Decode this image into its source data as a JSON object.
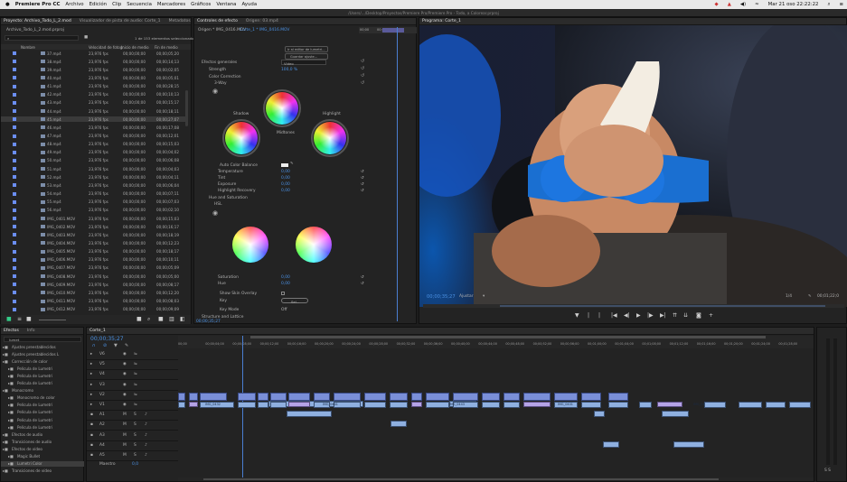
{
  "menubar": {
    "apple": "",
    "app": "Premiere Pro CC",
    "items": [
      "Archivo",
      "Edición",
      "Clip",
      "Secuencia",
      "Marcadores",
      "Gráficos",
      "Ventana",
      "Ayuda"
    ],
    "status": "Mar 21 oso  22:22:22"
  },
  "titlebar": {
    "path": "/Users/.../Desktop/Proyectos/Premiere Pro/Premiere Pro - Todo, a Colorear.prproj"
  },
  "project": {
    "tabs": [
      "Proyecto: Archivo_Todo_L_2.mod",
      "Visualizador de pista de audio: Corte_1",
      "Metadatos"
    ],
    "path": "Archivo_Todo_L_2.mod.prproj",
    "count": "1 de 153 elementos seleccionados",
    "columns": [
      "Nombre",
      "Velocidad de fotogr.",
      "Inicio de medio",
      "Fin de medio"
    ],
    "rows": [
      [
        "37.mp4",
        "23,976 fps",
        "00;00;00;00",
        "00;00;05;20"
      ],
      [
        "38.mp4",
        "23,976 fps",
        "00;00;00;00",
        "00;00;14;13"
      ],
      [
        "39.mp4",
        "23,976 fps",
        "00;00;00;00",
        "00;00;02;05"
      ],
      [
        "40.mp4",
        "23,976 fps",
        "00;00;00;00",
        "00;00;05;01"
      ],
      [
        "41.mp4",
        "23,976 fps",
        "00;00;00;00",
        "00;00;28;15"
      ],
      [
        "42.mp4",
        "23,976 fps",
        "00;00;00;00",
        "00;00;10;13"
      ],
      [
        "43.mp4",
        "23,976 fps",
        "00;00;00;00",
        "00;00;15;17"
      ],
      [
        "44.mp4",
        "23,976 fps",
        "00;00;00;00",
        "00;00;18;11"
      ],
      [
        "45.mp4",
        "23,976 fps",
        "00;00;00;00",
        "00;00;27;07"
      ],
      [
        "46.mp4",
        "23,976 fps",
        "00;00;00;00",
        "00;00;17;08"
      ],
      [
        "47.mp4",
        "23,976 fps",
        "00;00;00;00",
        "00;00;12;01"
      ],
      [
        "48.mp4",
        "23,976 fps",
        "00;00;00;00",
        "00;00;15;03"
      ],
      [
        "49.mp4",
        "23,976 fps",
        "00;00;00;00",
        "00;00;04;02"
      ],
      [
        "50.mp4",
        "23,976 fps",
        "00;00;00;00",
        "00;00;06;08"
      ],
      [
        "51.mp4",
        "23,976 fps",
        "00;00;00;00",
        "00;00;04;03"
      ],
      [
        "52.mp4",
        "23,976 fps",
        "00;00;00;00",
        "00;00;04;11"
      ],
      [
        "53.mp4",
        "23,976 fps",
        "00;00;00;00",
        "00;00;06;04"
      ],
      [
        "54.mp4",
        "23,976 fps",
        "00;00;00;00",
        "00;00;07;11"
      ],
      [
        "55.mp4",
        "23,976 fps",
        "00;00;00;00",
        "00;00;07;03"
      ],
      [
        "56.mp4",
        "23,976 fps",
        "00;00;00;00",
        "00;00;02;10"
      ],
      [
        "IMG_0401.MOV",
        "23,976 fps",
        "00;00;00;00",
        "00;00;15;03"
      ],
      [
        "IMG_0402.MOV",
        "23,976 fps",
        "00;00;00;00",
        "00;00;16;17"
      ],
      [
        "IMG_0403.MOV",
        "23,976 fps",
        "00;00;00;00",
        "00;00;18;19"
      ],
      [
        "IMG_0404.MOV",
        "23,976 fps",
        "00;00;00;00",
        "00;00;12;23"
      ],
      [
        "IMG_0405.MOV",
        "23,976 fps",
        "00;00;00;00",
        "00;00;18;17"
      ],
      [
        "IMG_0406.MOV",
        "23,976 fps",
        "00;00;00;00",
        "00;00;10;11"
      ],
      [
        "IMG_0407.MOV",
        "23,976 fps",
        "00;00;00;00",
        "00;00;05;09"
      ],
      [
        "IMG_0408.MOV",
        "23,976 fps",
        "00;00;00;00",
        "00;00;05;00"
      ],
      [
        "IMG_0409.MOV",
        "23,976 fps",
        "00;00;00;00",
        "00;00;08;17"
      ],
      [
        "IMG_0410.MOV",
        "23,976 fps",
        "00;00;00;00",
        "00;00;12;20"
      ],
      [
        "IMG_0411.MOV",
        "23,976 fps",
        "00;00;00;00",
        "00;00;08;03"
      ],
      [
        "IMG_0412.MOV",
        "23,976 fps",
        "00;00;00;00",
        "00;00;09;09"
      ]
    ]
  },
  "effects": {
    "tabs": [
      "Controles de efecto",
      "Origen: 03.mp4"
    ],
    "source": "Origen * IMG_0416.MOV",
    "sequence": "Corte_1 * IMG_0416.MOV",
    "timecode_ruler": [
      "00;00",
      "00;00;43;03"
    ],
    "buttons": [
      "Ir al editor de lumetri...",
      "Guardar ajuste..."
    ],
    "fx_section": "Efectos generales",
    "luminance": "Video",
    "strength_label": "Strength",
    "strength_value": "100,0 %",
    "color_correction": "Color Correction",
    "three_way": "3-Way",
    "shadow": "Shadow",
    "midtone": "Midtones",
    "highlight": "Highlight",
    "auto_color": "Auto Color Balance",
    "params": [
      {
        "name": "Temperature",
        "value": "0,00"
      },
      {
        "name": "Tint",
        "value": "0,00"
      },
      {
        "name": "Exposure",
        "value": "0,00"
      },
      {
        "name": "Highlight Recovery",
        "value": "0,00"
      }
    ],
    "hue_sat": "Hue and Saturation",
    "hsl": "HSL",
    "bottom_params": [
      {
        "name": "Saturation",
        "value": "0,00"
      },
      {
        "name": "Hue",
        "value": "0,00"
      }
    ],
    "show_overlay": "Show Skin Overlay",
    "key": "Key",
    "key_btn": "Sel...",
    "key_mode": "Key Mode",
    "key_mode_value": "Off",
    "structure": "Structure and Lattice",
    "timecode": "00;00;35;27"
  },
  "program": {
    "tab": "Programa: Corte_1",
    "timecode": "00;00;35;27",
    "fit": "Ajustar",
    "ratio": "1/4",
    "duration": "00;01;22;0"
  },
  "bins": {
    "tabs": [
      "Efectos",
      "Info"
    ],
    "search": "lumet",
    "items": [
      "Ajustes preestablecidos",
      "Ajustes preestablecidos L",
      "Corrección de color",
      "Película de Lumetri",
      "Película de Lumetri",
      "Película de Lumetri",
      "Monocromo",
      "Monocromo de color",
      "Película de Lumetri",
      "Película de Lumetri",
      "Película de Lumetri",
      "Película de Lumetri",
      "Efectos de audio",
      "Transiciones de audio",
      "Efectos de vídeo",
      "Magic Bullet",
      "Lumetri Color",
      "Transiciones de vídeo"
    ]
  },
  "timeline": {
    "tab": "Corte_1",
    "timecode": "00;00;35;27",
    "ticks": [
      "00;00",
      "00;00;04;00",
      "00;00;08;00",
      "00;00;12;00",
      "00;00;16;00",
      "00;00;20;00",
      "00;00;24;00",
      "00;00;28;00",
      "00;00;32;00",
      "00;00;36;00",
      "00;00;40;00",
      "00;00;44;00",
      "00;00;48;00",
      "00;00;52;00",
      "00;00;56;00",
      "00;01;00;00",
      "00;01;04;00",
      "00;01;08;00",
      "00;01;12;00",
      "00;01;16;00",
      "00;01;20;00",
      "00;01;24;00",
      "00;01;28;00"
    ],
    "tracks": [
      "V6",
      "V5",
      "V4",
      "V3",
      "V2",
      "V1",
      "A1",
      "A2",
      "A3",
      "A4",
      "A5"
    ],
    "master": "Maestro",
    "master_value": "0,0",
    "clip_labels": [
      "IMG_0432",
      "IMG_0441",
      "IMG_0443",
      "IMG_0401",
      "IMG_04"
    ]
  },
  "colors": {
    "accent": "#4a90e2",
    "clip_video": "#8fb0e0",
    "clip_fx": "#b5a3e6",
    "clip_audio": "#7a8fd8"
  }
}
